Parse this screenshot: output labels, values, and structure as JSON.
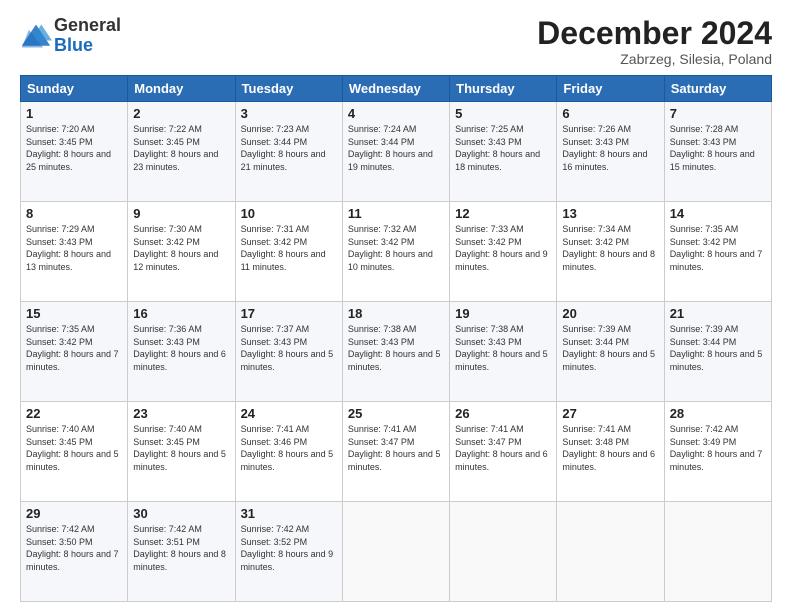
{
  "logo": {
    "general": "General",
    "blue": "Blue"
  },
  "header": {
    "month": "December 2024",
    "location": "Zabrzeg, Silesia, Poland"
  },
  "days_of_week": [
    "Sunday",
    "Monday",
    "Tuesday",
    "Wednesday",
    "Thursday",
    "Friday",
    "Saturday"
  ],
  "weeks": [
    [
      {
        "day": 1,
        "sunrise": "7:20 AM",
        "sunset": "3:45 PM",
        "daylight": "8 hours and 25 minutes."
      },
      {
        "day": 2,
        "sunrise": "7:22 AM",
        "sunset": "3:45 PM",
        "daylight": "8 hours and 23 minutes."
      },
      {
        "day": 3,
        "sunrise": "7:23 AM",
        "sunset": "3:44 PM",
        "daylight": "8 hours and 21 minutes."
      },
      {
        "day": 4,
        "sunrise": "7:24 AM",
        "sunset": "3:44 PM",
        "daylight": "8 hours and 19 minutes."
      },
      {
        "day": 5,
        "sunrise": "7:25 AM",
        "sunset": "3:43 PM",
        "daylight": "8 hours and 18 minutes."
      },
      {
        "day": 6,
        "sunrise": "7:26 AM",
        "sunset": "3:43 PM",
        "daylight": "8 hours and 16 minutes."
      },
      {
        "day": 7,
        "sunrise": "7:28 AM",
        "sunset": "3:43 PM",
        "daylight": "8 hours and 15 minutes."
      }
    ],
    [
      {
        "day": 8,
        "sunrise": "7:29 AM",
        "sunset": "3:43 PM",
        "daylight": "8 hours and 13 minutes."
      },
      {
        "day": 9,
        "sunrise": "7:30 AM",
        "sunset": "3:42 PM",
        "daylight": "8 hours and 12 minutes."
      },
      {
        "day": 10,
        "sunrise": "7:31 AM",
        "sunset": "3:42 PM",
        "daylight": "8 hours and 11 minutes."
      },
      {
        "day": 11,
        "sunrise": "7:32 AM",
        "sunset": "3:42 PM",
        "daylight": "8 hours and 10 minutes."
      },
      {
        "day": 12,
        "sunrise": "7:33 AM",
        "sunset": "3:42 PM",
        "daylight": "8 hours and 9 minutes."
      },
      {
        "day": 13,
        "sunrise": "7:34 AM",
        "sunset": "3:42 PM",
        "daylight": "8 hours and 8 minutes."
      },
      {
        "day": 14,
        "sunrise": "7:35 AM",
        "sunset": "3:42 PM",
        "daylight": "8 hours and 7 minutes."
      }
    ],
    [
      {
        "day": 15,
        "sunrise": "7:35 AM",
        "sunset": "3:42 PM",
        "daylight": "8 hours and 7 minutes."
      },
      {
        "day": 16,
        "sunrise": "7:36 AM",
        "sunset": "3:43 PM",
        "daylight": "8 hours and 6 minutes."
      },
      {
        "day": 17,
        "sunrise": "7:37 AM",
        "sunset": "3:43 PM",
        "daylight": "8 hours and 5 minutes."
      },
      {
        "day": 18,
        "sunrise": "7:38 AM",
        "sunset": "3:43 PM",
        "daylight": "8 hours and 5 minutes."
      },
      {
        "day": 19,
        "sunrise": "7:38 AM",
        "sunset": "3:43 PM",
        "daylight": "8 hours and 5 minutes."
      },
      {
        "day": 20,
        "sunrise": "7:39 AM",
        "sunset": "3:44 PM",
        "daylight": "8 hours and 5 minutes."
      },
      {
        "day": 21,
        "sunrise": "7:39 AM",
        "sunset": "3:44 PM",
        "daylight": "8 hours and 5 minutes."
      }
    ],
    [
      {
        "day": 22,
        "sunrise": "7:40 AM",
        "sunset": "3:45 PM",
        "daylight": "8 hours and 5 minutes."
      },
      {
        "day": 23,
        "sunrise": "7:40 AM",
        "sunset": "3:45 PM",
        "daylight": "8 hours and 5 minutes."
      },
      {
        "day": 24,
        "sunrise": "7:41 AM",
        "sunset": "3:46 PM",
        "daylight": "8 hours and 5 minutes."
      },
      {
        "day": 25,
        "sunrise": "7:41 AM",
        "sunset": "3:47 PM",
        "daylight": "8 hours and 5 minutes."
      },
      {
        "day": 26,
        "sunrise": "7:41 AM",
        "sunset": "3:47 PM",
        "daylight": "8 hours and 6 minutes."
      },
      {
        "day": 27,
        "sunrise": "7:41 AM",
        "sunset": "3:48 PM",
        "daylight": "8 hours and 6 minutes."
      },
      {
        "day": 28,
        "sunrise": "7:42 AM",
        "sunset": "3:49 PM",
        "daylight": "8 hours and 7 minutes."
      }
    ],
    [
      {
        "day": 29,
        "sunrise": "7:42 AM",
        "sunset": "3:50 PM",
        "daylight": "8 hours and 7 minutes."
      },
      {
        "day": 30,
        "sunrise": "7:42 AM",
        "sunset": "3:51 PM",
        "daylight": "8 hours and 8 minutes."
      },
      {
        "day": 31,
        "sunrise": "7:42 AM",
        "sunset": "3:52 PM",
        "daylight": "8 hours and 9 minutes."
      },
      null,
      null,
      null,
      null
    ]
  ],
  "labels": {
    "sunrise": "Sunrise:",
    "sunset": "Sunset:",
    "daylight": "Daylight:"
  }
}
